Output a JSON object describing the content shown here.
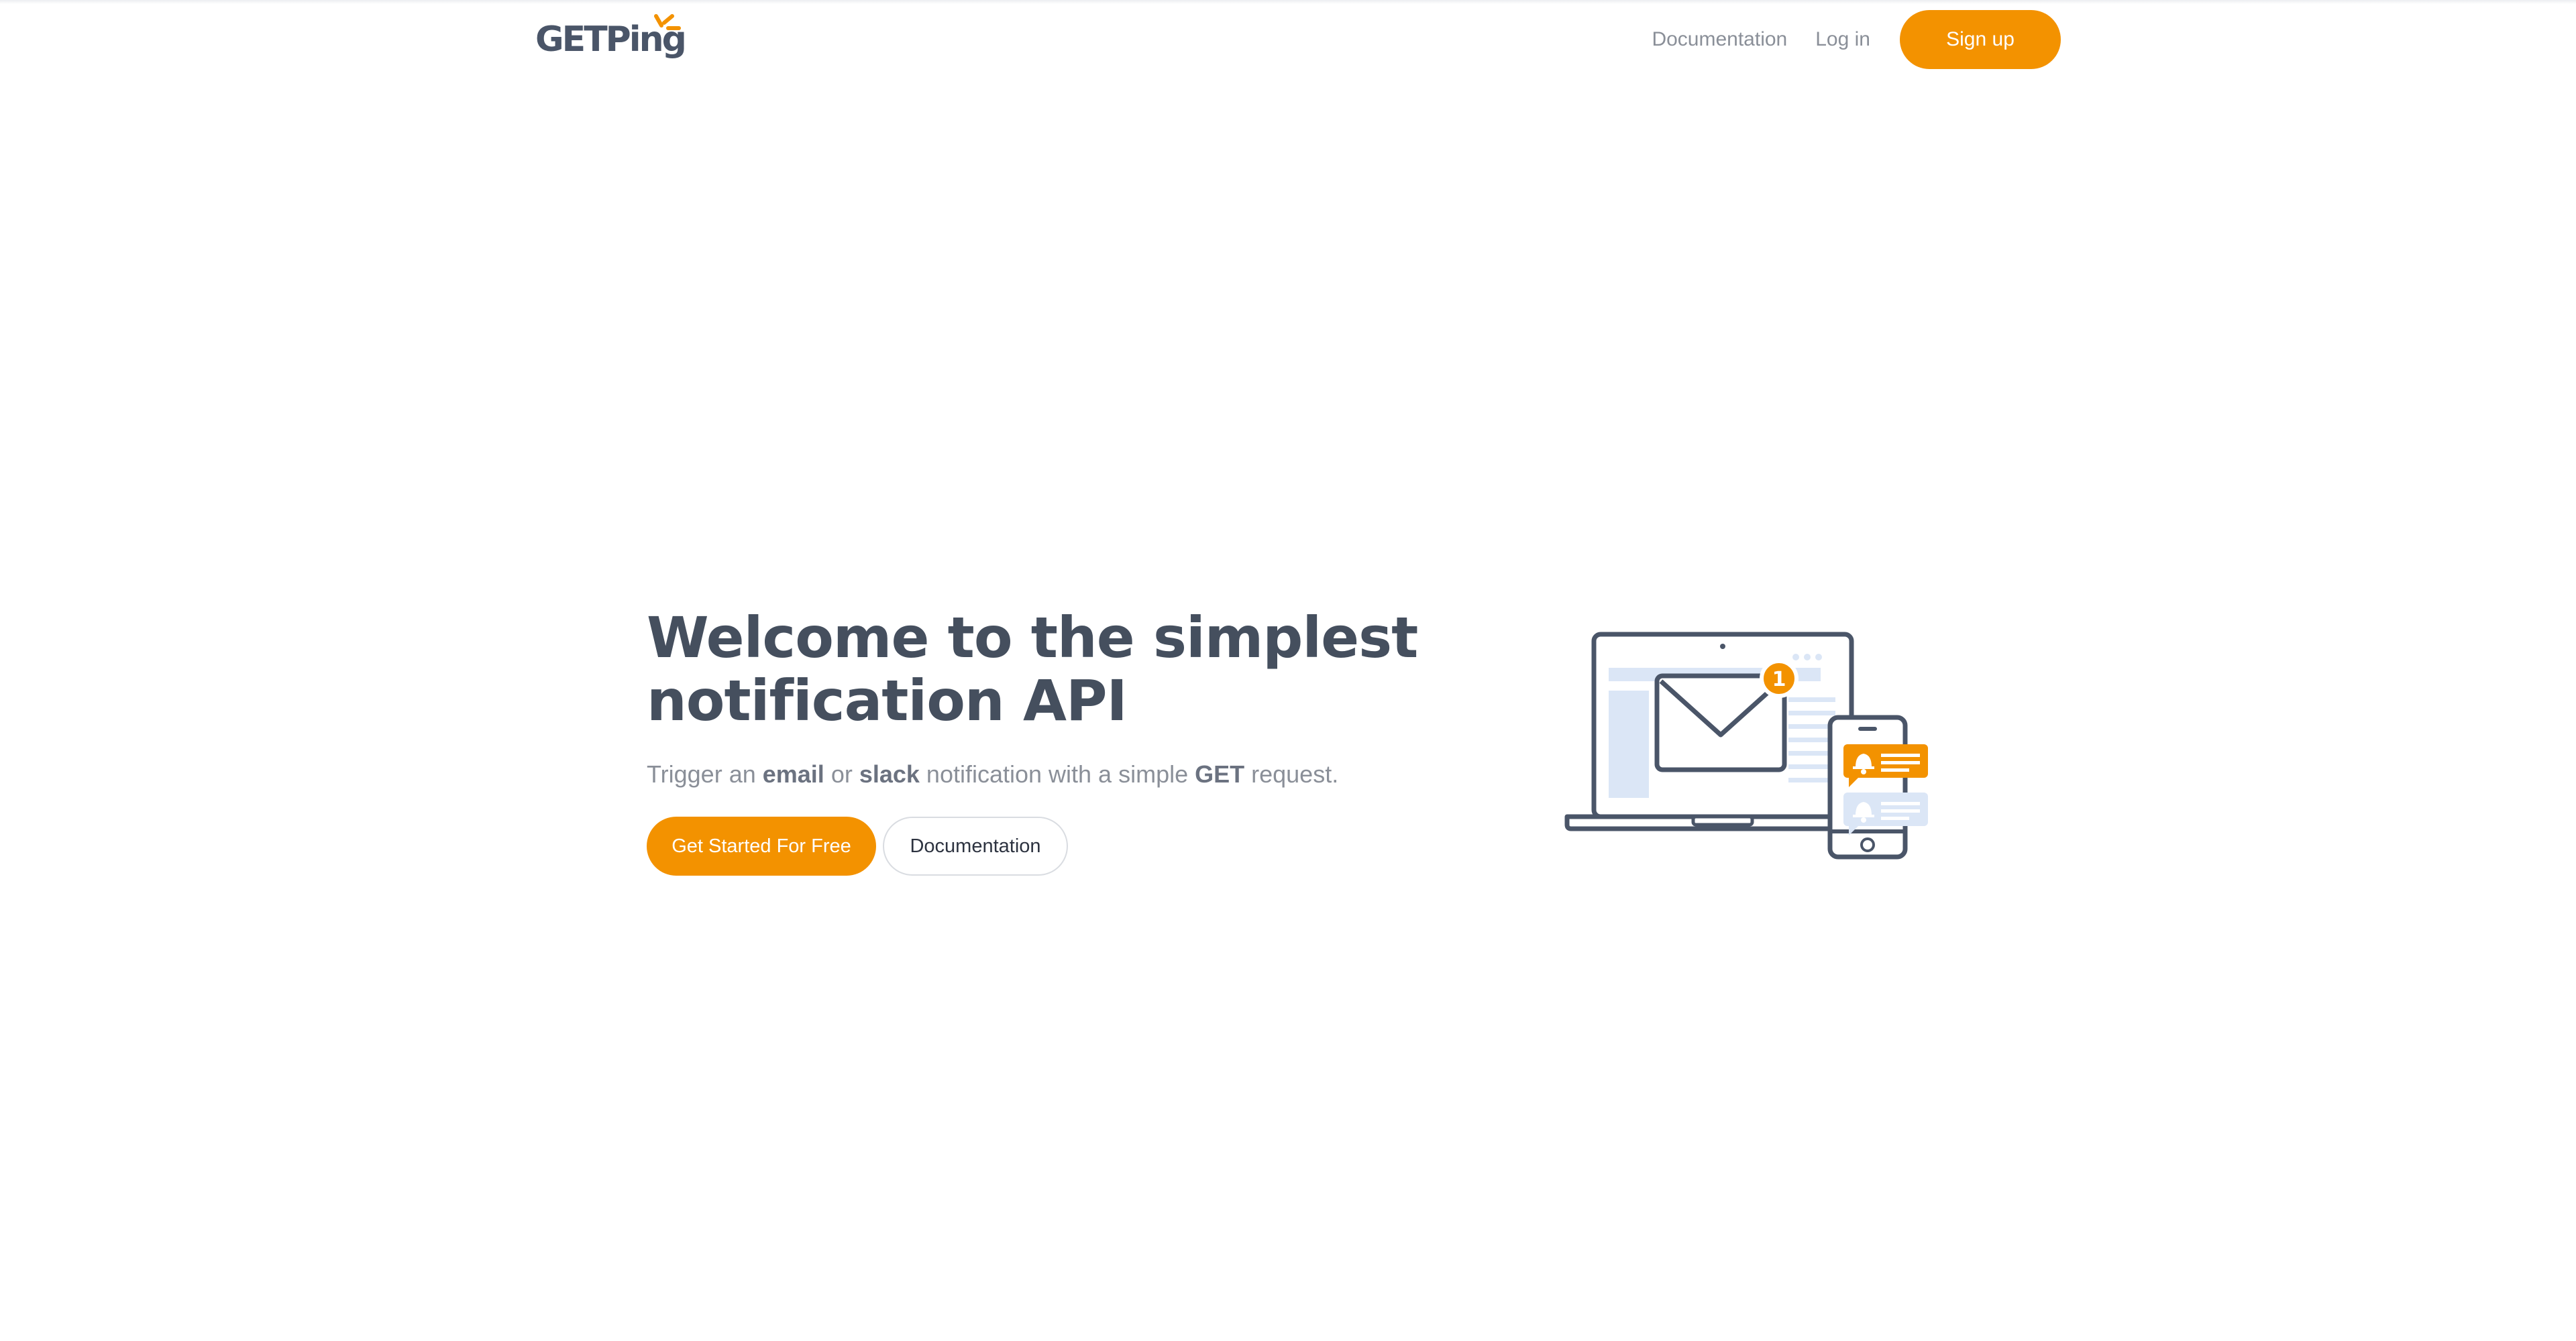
{
  "header": {
    "logo_text": "GETPing",
    "nav": {
      "documentation": "Documentation",
      "login": "Log in",
      "signup": "Sign up"
    }
  },
  "hero": {
    "title_line1": "Welcome to the simplest",
    "title_line2": "notification API",
    "subtitle": {
      "part1": "Trigger an ",
      "email": "email",
      "part2": " or ",
      "slack": "slack",
      "part3": " notification with a simple ",
      "get": "GET",
      "part4": " request."
    },
    "primary_button": "Get Started For Free",
    "secondary_button": "Documentation"
  },
  "illustration": {
    "badge_count": "1"
  },
  "colors": {
    "accent": "#f39200",
    "heading": "#454f5e",
    "muted": "#8a8f98",
    "outline": "#4a5568",
    "light_blue": "#dbe6f6"
  }
}
